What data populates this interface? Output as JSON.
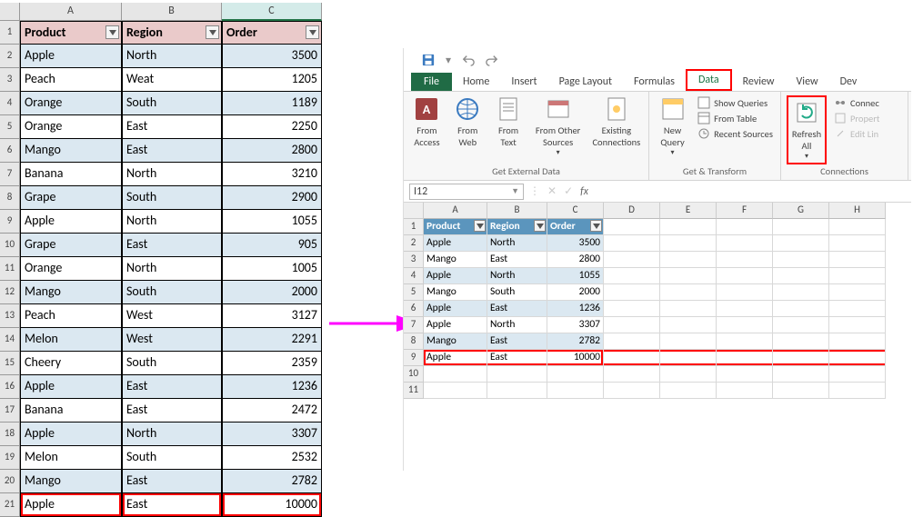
{
  "left_table": {
    "col_letters": [
      "A",
      "B",
      "C"
    ],
    "headers": [
      "Product",
      "Region",
      "Order"
    ],
    "rows": [
      {
        "p": "Apple",
        "r": "North",
        "o": 3500
      },
      {
        "p": "Peach",
        "r": "Weat",
        "o": 1205
      },
      {
        "p": "Orange",
        "r": "South",
        "o": 1189
      },
      {
        "p": "Orange",
        "r": "East",
        "o": 2250
      },
      {
        "p": "Mango",
        "r": "East",
        "o": 2800
      },
      {
        "p": "Banana",
        "r": "North",
        "o": 3210
      },
      {
        "p": "Grape",
        "r": "South",
        "o": 2900
      },
      {
        "p": "Apple",
        "r": "North",
        "o": 1055
      },
      {
        "p": "Grape",
        "r": "East",
        "o": 905
      },
      {
        "p": "Orange",
        "r": "North",
        "o": 1005
      },
      {
        "p": "Mango",
        "r": "South",
        "o": 2000
      },
      {
        "p": "Peach",
        "r": "West",
        "o": 3127
      },
      {
        "p": "Melon",
        "r": "West",
        "o": 2291
      },
      {
        "p": "Cheery",
        "r": "South",
        "o": 2359
      },
      {
        "p": "Apple",
        "r": "East",
        "o": 1236
      },
      {
        "p": "Banana",
        "r": "East",
        "o": 2472
      },
      {
        "p": "Apple",
        "r": "North",
        "o": 3307
      },
      {
        "p": "Melon",
        "r": "South",
        "o": 2532
      },
      {
        "p": "Mango",
        "r": "East",
        "o": 2782
      },
      {
        "p": "Apple",
        "r": "East",
        "o": 10000
      }
    ]
  },
  "ribbon": {
    "tabs": {
      "file": "File",
      "home": "Home",
      "insert": "Insert",
      "page_layout": "Page Layout",
      "formulas": "Formulas",
      "data": "Data",
      "review": "Review",
      "view": "View",
      "dev": "Dev"
    },
    "groups": {
      "get_external": {
        "label": "Get External Data",
        "access": "From Access",
        "web": "From Web",
        "text": "From Text",
        "other": "From Other Sources",
        "existing": "Existing Connections"
      },
      "get_transform": {
        "label": "Get & Transform",
        "new_query": "New Query",
        "show_q": "Show Queries",
        "from_table": "From Table",
        "recent": "Recent Sources"
      },
      "connections": {
        "label": "Connections",
        "refresh": "Refresh All",
        "conn": "Connec",
        "prop": "Propert",
        "edit": "Edit Lin"
      }
    }
  },
  "namebox": {
    "value": "I12",
    "fx": "fx"
  },
  "right_table": {
    "col_letters": [
      "A",
      "B",
      "C",
      "D",
      "E",
      "F",
      "G",
      "H"
    ],
    "headers": [
      "Product",
      "Region",
      "Order"
    ],
    "rows": [
      {
        "p": "Apple",
        "r": "North",
        "o": 3500
      },
      {
        "p": "Mango",
        "r": "East",
        "o": 2800
      },
      {
        "p": "Apple",
        "r": "North",
        "o": 1055
      },
      {
        "p": "Mango",
        "r": "South",
        "o": 2000
      },
      {
        "p": "Apple",
        "r": "East",
        "o": 1236
      },
      {
        "p": "Apple",
        "r": "North",
        "o": 3307
      },
      {
        "p": "Mango",
        "r": "East",
        "o": 2782
      },
      {
        "p": "Apple",
        "r": "East",
        "o": 10000
      }
    ]
  }
}
